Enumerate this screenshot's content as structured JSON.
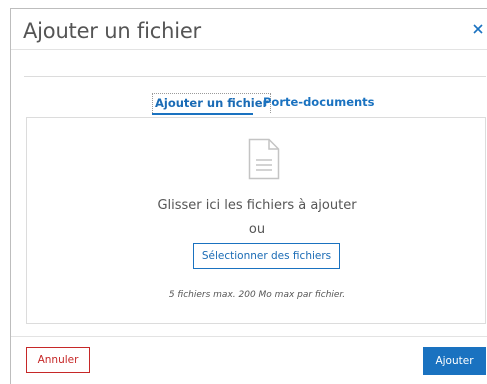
{
  "dialog": {
    "title": "Ajouter un fichier",
    "close_icon": "close-icon",
    "close_glyph": "×"
  },
  "tabs": [
    {
      "label": "Ajouter un fichier",
      "active": true
    },
    {
      "label": "Porte-documents",
      "active": false
    }
  ],
  "dropzone": {
    "icon": "document-icon",
    "drop_text": "Glisser ici les fichiers à ajouter",
    "or_text": "ou",
    "select_button": "Sélectionner des fichiers",
    "limits_text": "5 fichiers max. 200 Mo max par fichier."
  },
  "footer": {
    "cancel_label": "Annuler",
    "add_label": "Ajouter"
  },
  "colors": {
    "accent": "#1a72c0",
    "cancel": "#c62828",
    "text": "#555555",
    "border": "#dcdcdc"
  }
}
